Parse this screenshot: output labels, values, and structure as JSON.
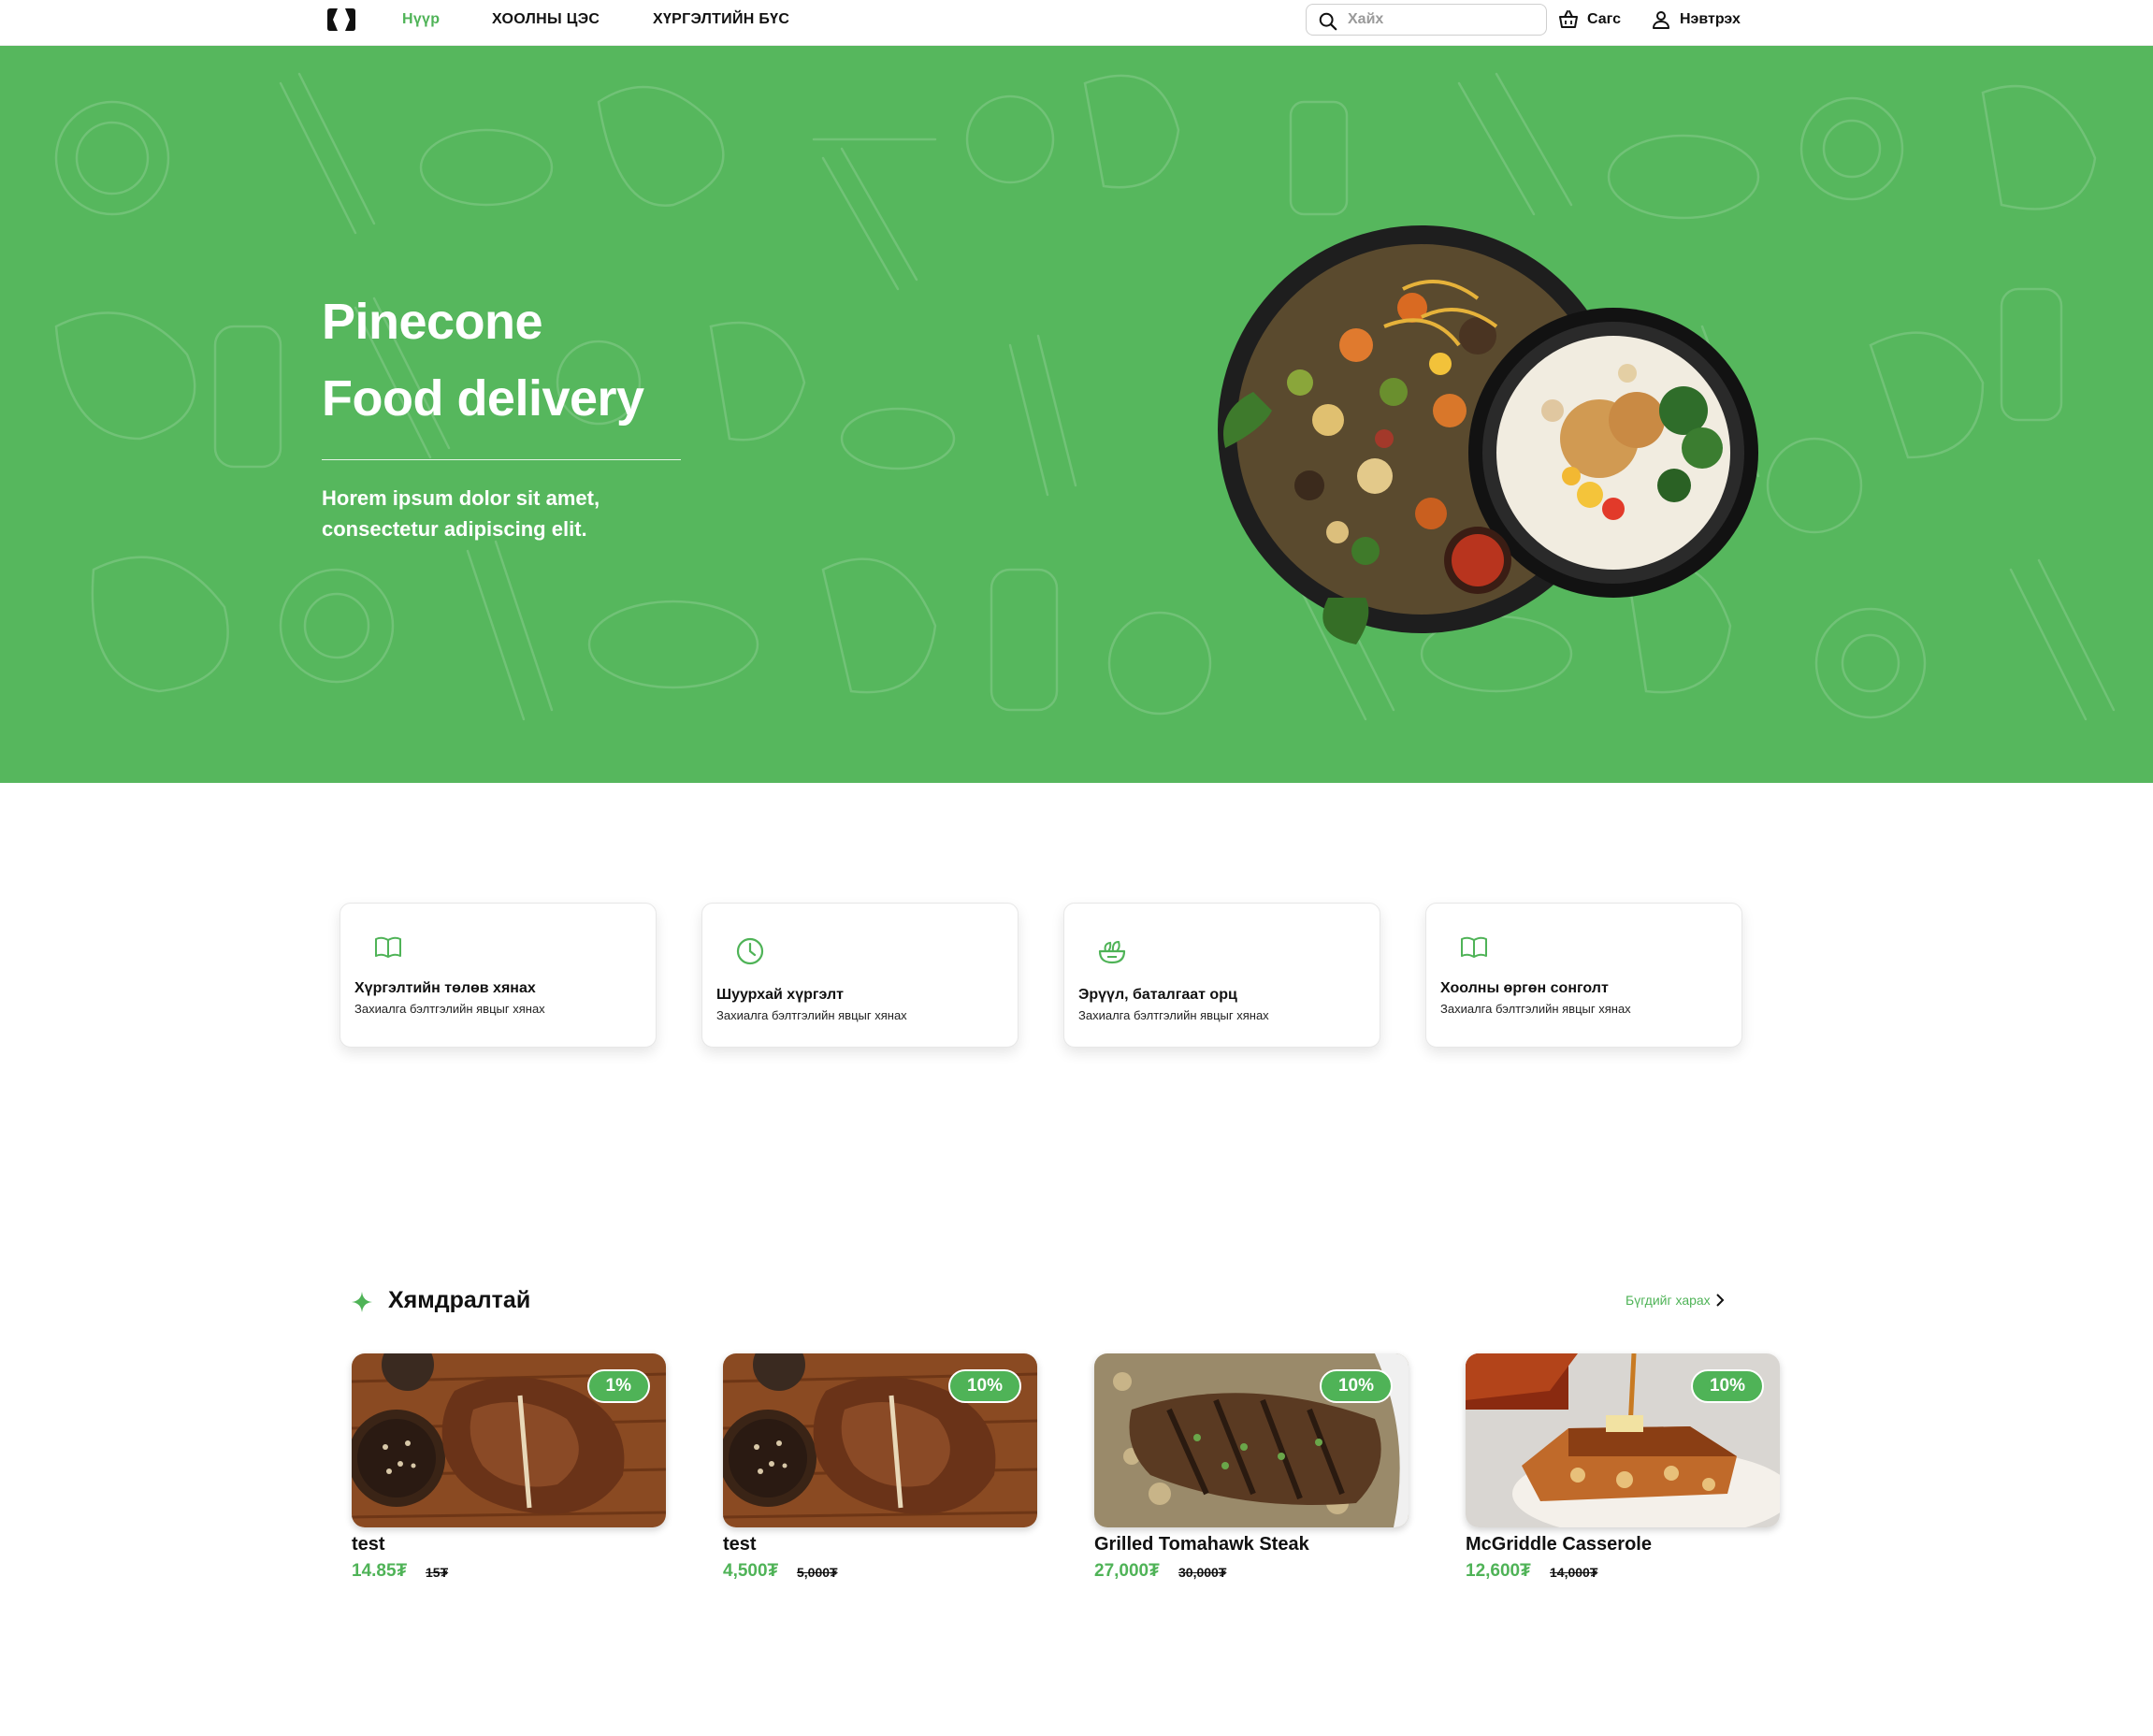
{
  "header": {
    "nav": {
      "home": "Нүүр",
      "menu": "ХООЛНЫ ЦЭС",
      "delivery": "ХҮРГЭЛТИЙН БҮС"
    },
    "search": {
      "placeholder": "Хайх",
      "value": ""
    },
    "cart_label": "Сагс",
    "login_label": "Нэвтрэх"
  },
  "hero": {
    "title_line1": "Pinecone",
    "title_line2": "Food delivery",
    "subtitle_line1": "Horem ipsum dolor sit amet,",
    "subtitle_line2": "consectetur adipiscing elit."
  },
  "features": [
    {
      "icon": "book-open-icon",
      "title": "Хүргэлтийн төлөв хянах",
      "subtitle": "Захиалга бэлтгэлийн явцыг хянах"
    },
    {
      "icon": "clock-icon",
      "title": "Шуурхай хүргэлт",
      "subtitle": "Захиалга бэлтгэлийн явцыг хянах"
    },
    {
      "icon": "salad-bowl-icon",
      "title": "Эрүүл, баталгаат орц",
      "subtitle": "Захиалга бэлтгэлийн явцыг хянах"
    },
    {
      "icon": "book-open-icon",
      "title": "Хоолны өргөн сонголт",
      "subtitle": "Захиалга бэлтгэлийн явцыг хянах"
    }
  ],
  "discount_section": {
    "title": "Хямдралтай",
    "see_all": "Бүгдийг харах",
    "products": [
      {
        "name": "test",
        "discount": "1%",
        "price": "14.85₮",
        "old_price": "15₮",
        "image": "t-bone-steak"
      },
      {
        "name": "test",
        "discount": "10%",
        "price": "4,500₮",
        "old_price": "5,000₮",
        "image": "t-bone-steak"
      },
      {
        "name": "Grilled Tomahawk Steak",
        "discount": "10%",
        "price": "27,000₮",
        "old_price": "30,000₮",
        "image": "grilled-steak"
      },
      {
        "name": "McGriddle Casserole",
        "discount": "10%",
        "price": "12,600₮",
        "old_price": "14,000₮",
        "image": "casserole"
      }
    ]
  },
  "colors": {
    "brand_green": "#56B75D",
    "accent_green": "#4FB357",
    "text": "#111111"
  }
}
